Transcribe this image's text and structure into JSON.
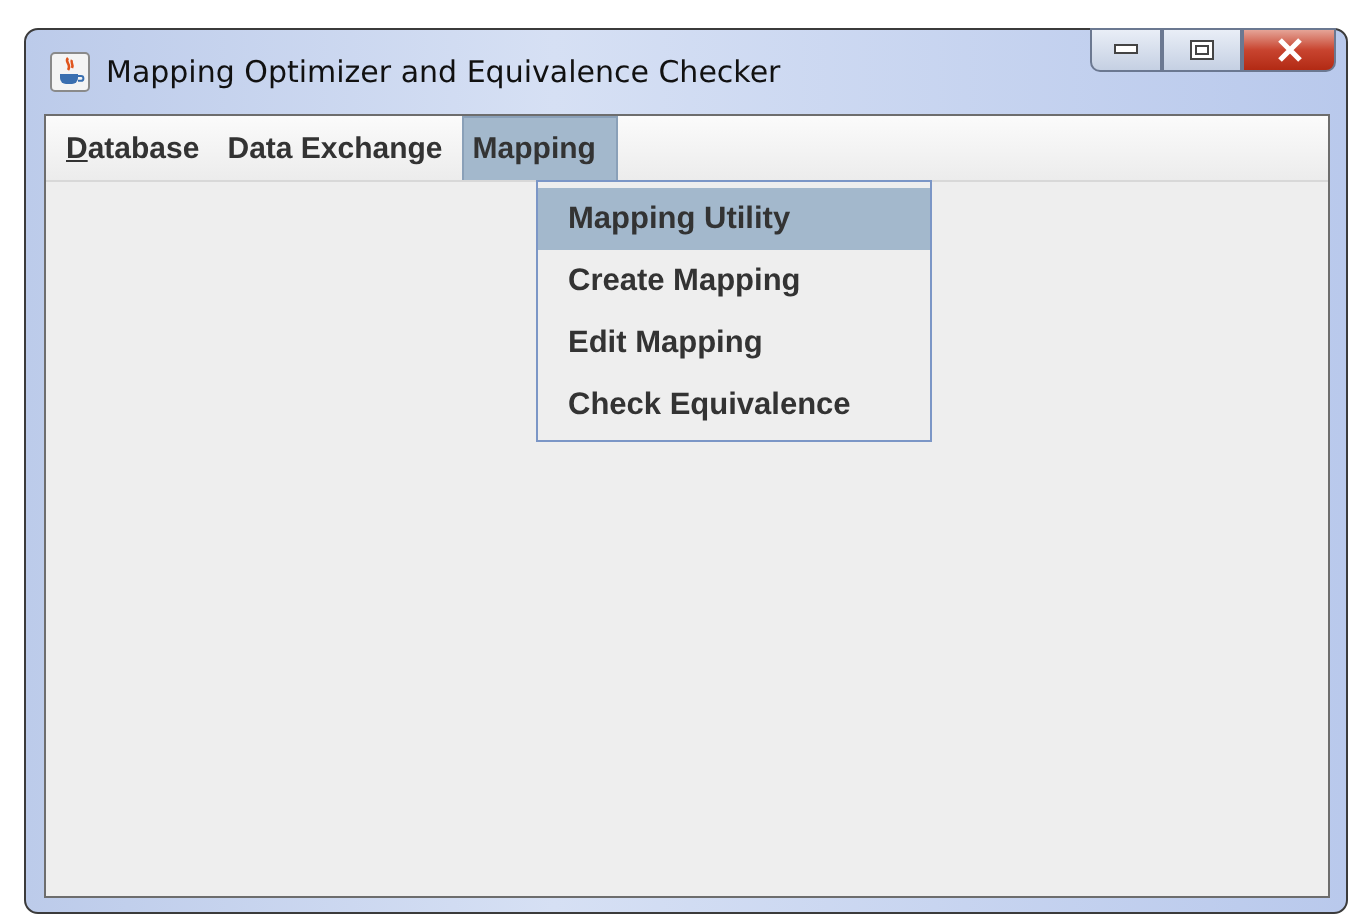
{
  "window": {
    "title": "Mapping Optimizer and Equivalence Checker"
  },
  "menu_bar": [
    {
      "label": "Database",
      "selected": false,
      "first_letter_underlined": true
    },
    {
      "label": "Data Exchange",
      "selected": false,
      "first_letter_underlined": false
    },
    {
      "label": "Mapping",
      "selected": true,
      "first_letter_underlined": false
    }
  ],
  "dropdown": {
    "items": [
      {
        "label": "Mapping Utility",
        "selected": true
      },
      {
        "label": "Create Mapping",
        "selected": false
      },
      {
        "label": "Edit Mapping",
        "selected": false
      },
      {
        "label": "Check Equivalence",
        "selected": false
      }
    ]
  }
}
